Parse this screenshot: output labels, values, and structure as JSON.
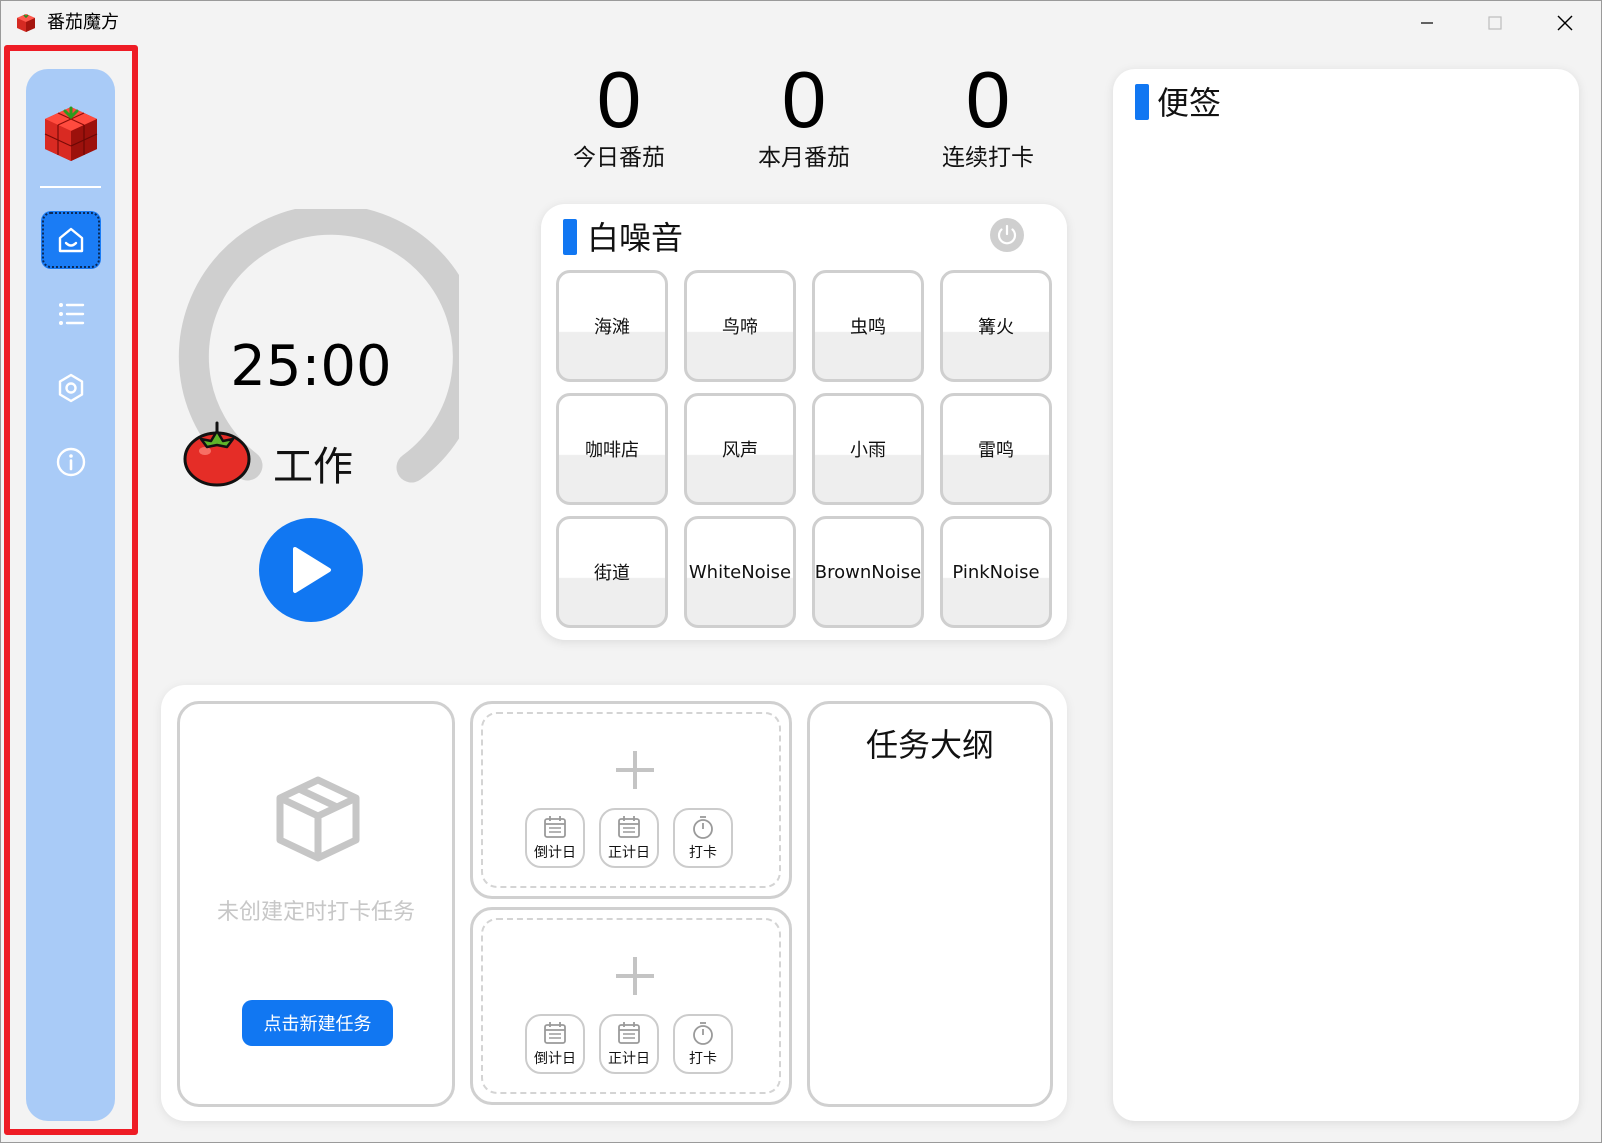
{
  "window": {
    "title": "番茄魔方"
  },
  "stats": {
    "today_value": "0",
    "today_label": "今日番茄",
    "month_value": "0",
    "month_label": "本月番茄",
    "streak_value": "0",
    "streak_label": "连续打卡"
  },
  "timer": {
    "time": "25:00",
    "mode": "工作"
  },
  "white_noise": {
    "title": "白噪音",
    "sounds": [
      "海滩",
      "鸟啼",
      "虫鸣",
      "篝火",
      "咖啡店",
      "风声",
      "小雨",
      "雷鸣",
      "街道",
      "WhiteNoise",
      "BrownNoise",
      "PinkNoise"
    ]
  },
  "checkin": {
    "empty_text": "未创建定时打卡任务",
    "new_task_label": "点击新建任务"
  },
  "quick_add": {
    "buttons": [
      "倒计日",
      "正计日",
      "打卡"
    ]
  },
  "outline": {
    "title": "任务大纲"
  },
  "notes": {
    "title": "便签"
  },
  "sidebar": {
    "items": [
      "home-icon",
      "list-icon",
      "settings-icon",
      "info-icon"
    ]
  },
  "colors": {
    "accent": "#1177f2",
    "sidebar_bg": "#a9cbf7",
    "highlight": "#ee1c25"
  }
}
